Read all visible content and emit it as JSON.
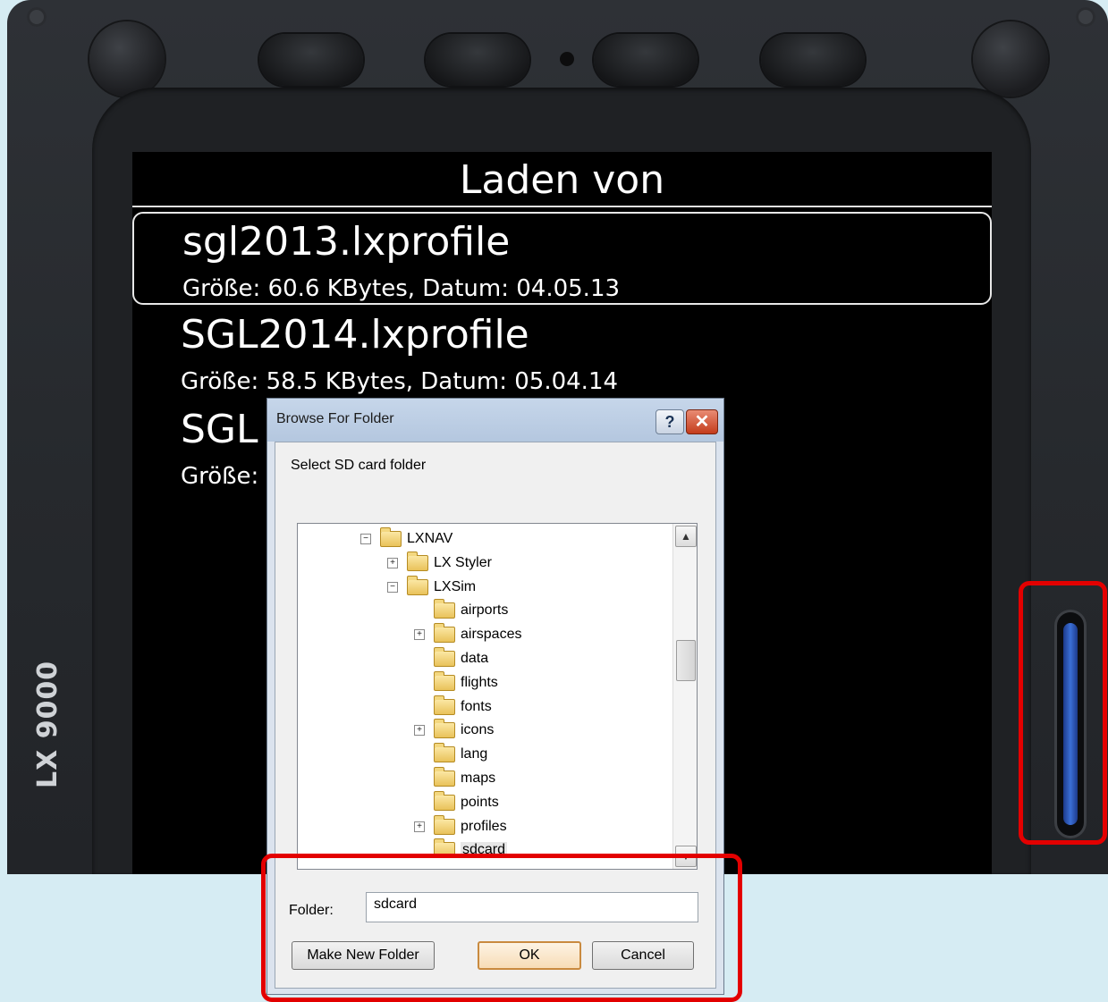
{
  "device": {
    "model_label": "LX 9000"
  },
  "screen": {
    "title": "Laden von",
    "files": [
      {
        "name": "sgl2013.lxprofile",
        "meta": "Größe: 60.6 KBytes, Datum: 04.05.13",
        "selected": true
      },
      {
        "name": "SGL2014.lxprofile",
        "meta": "Größe: 58.5 KBytes, Datum: 05.04.14",
        "selected": false
      },
      {
        "name": "SGL",
        "meta": "Größe:",
        "selected": false
      }
    ]
  },
  "dialog": {
    "title": "Browse For Folder",
    "help_label": "?",
    "close_label": "✕",
    "prompt": "Select SD card folder",
    "tree": [
      {
        "label": "LXNAV",
        "expander": "⊟",
        "level": 0,
        "icon": "folder-icon"
      },
      {
        "label": "LX Styler",
        "expander": "⊞",
        "level": 1,
        "icon": "folder-icon"
      },
      {
        "label": "LXSim",
        "expander": "⊟",
        "level": 1,
        "icon": "folder-icon"
      },
      {
        "label": "airports",
        "expander": "",
        "level": 2,
        "icon": "folder-icon"
      },
      {
        "label": "airspaces",
        "expander": "⊞",
        "level": 2,
        "icon": "folder-icon"
      },
      {
        "label": "data",
        "expander": "",
        "level": 2,
        "icon": "folder-icon"
      },
      {
        "label": "flights",
        "expander": "",
        "level": 2,
        "icon": "folder-icon"
      },
      {
        "label": "fonts",
        "expander": "",
        "level": 2,
        "icon": "folder-icon"
      },
      {
        "label": "icons",
        "expander": "⊞",
        "level": 2,
        "icon": "folder-icon"
      },
      {
        "label": "lang",
        "expander": "",
        "level": 2,
        "icon": "folder-icon"
      },
      {
        "label": "maps",
        "expander": "",
        "level": 2,
        "icon": "folder-icon"
      },
      {
        "label": "points",
        "expander": "",
        "level": 2,
        "icon": "folder-icon"
      },
      {
        "label": "profiles",
        "expander": "⊞",
        "level": 2,
        "icon": "folder-icon"
      },
      {
        "label": "sdcard",
        "expander": "",
        "level": 2,
        "icon": "folder-icon",
        "selected": true
      }
    ],
    "folder_label": "Folder:",
    "folder_value": "sdcard",
    "buttons": {
      "make_new_folder": "Make New Folder",
      "ok": "OK",
      "cancel": "Cancel"
    }
  },
  "colors": {
    "highlight": "#e30000",
    "sd_card": "#3b6fd6"
  }
}
